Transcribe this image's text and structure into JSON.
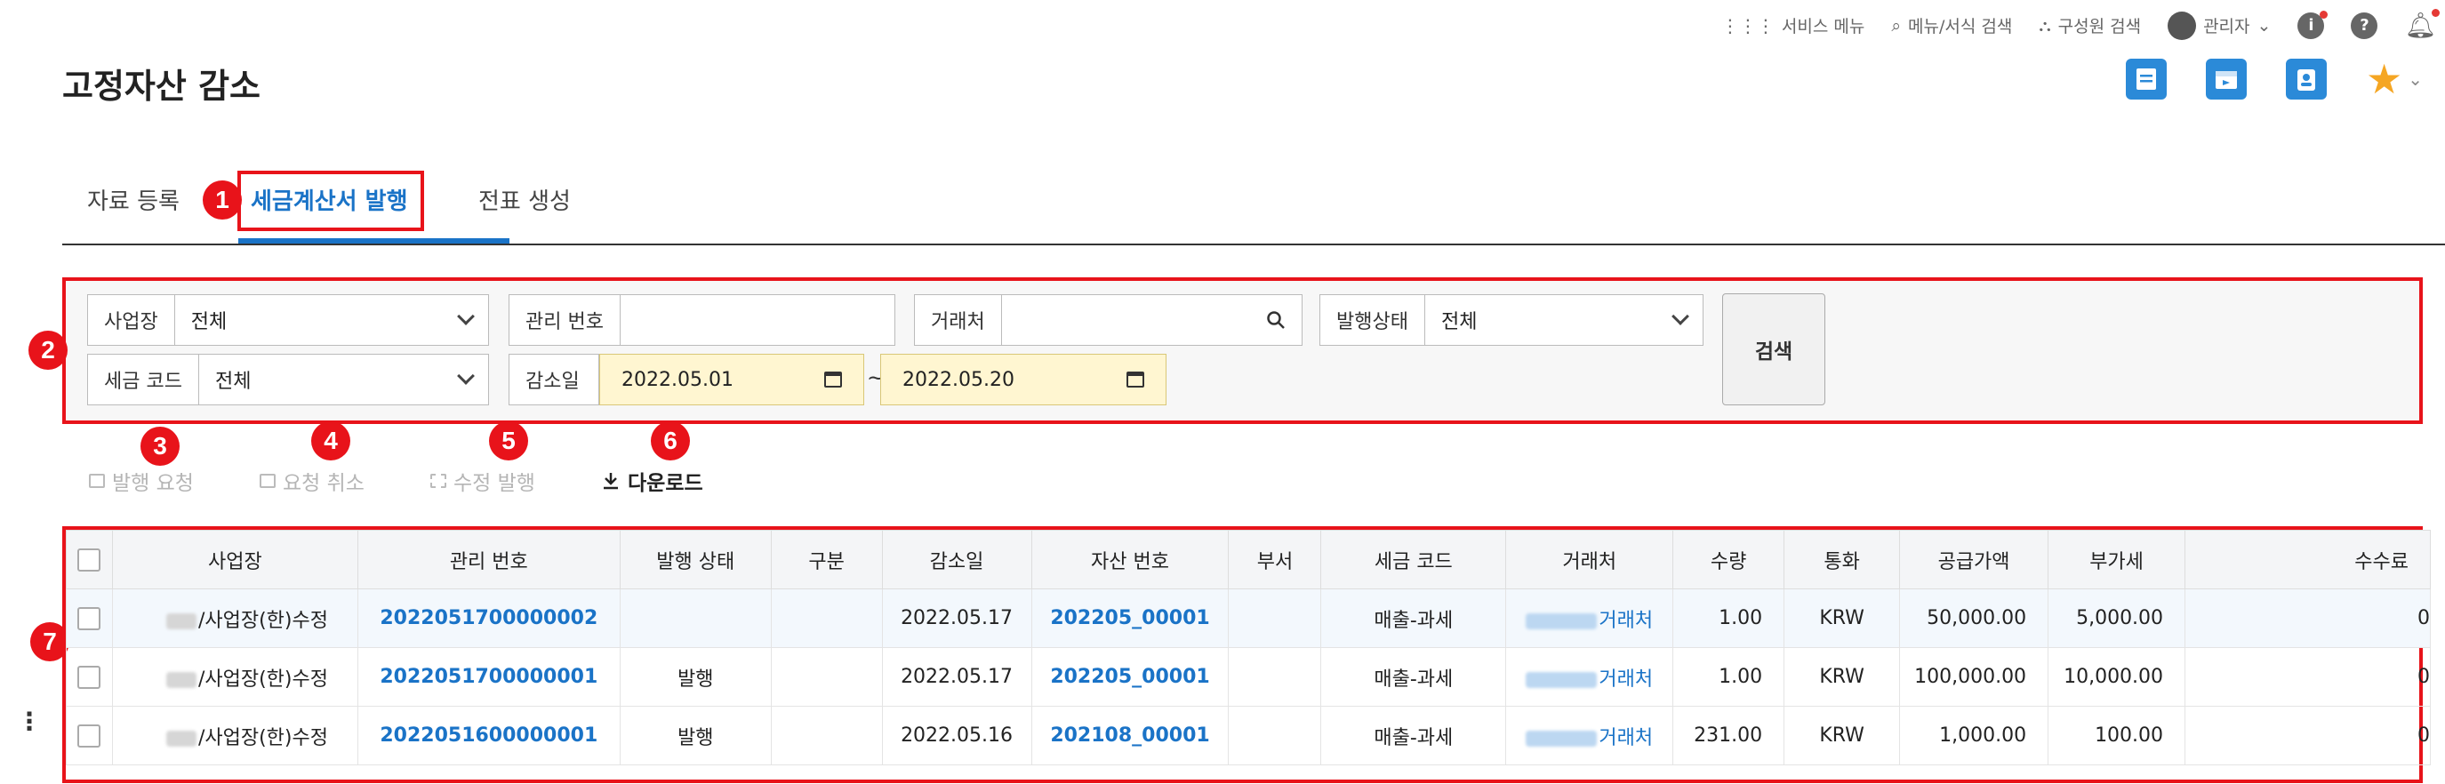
{
  "topbar": {
    "service_menu": "서비스 메뉴",
    "menu_search": "메뉴/서식 검색",
    "member_search": "구성원 검색",
    "user_name": "관리자"
  },
  "page": {
    "title": "고정자산 감소"
  },
  "tabs": [
    {
      "label": "자료 등록",
      "active": false
    },
    {
      "label": "세금계산서 발행",
      "active": true
    },
    {
      "label": "전표 생성",
      "active": false
    }
  ],
  "annotation_badges": [
    "1",
    "2",
    "3",
    "4",
    "5",
    "6",
    "7"
  ],
  "filters": {
    "business_place": {
      "label": "사업장",
      "value": "전체"
    },
    "mgmt_no": {
      "label": "관리 번호",
      "value": ""
    },
    "vendor": {
      "label": "거래처",
      "value": ""
    },
    "issue_status": {
      "label": "발행상태",
      "value": "전체"
    },
    "tax_code": {
      "label": "세금 코드",
      "value": "전체"
    },
    "decrease_date": {
      "label": "감소일",
      "from": "2022.05.01",
      "to": "2022.05.20",
      "separator": "~"
    },
    "search_button": "검색"
  },
  "actions": [
    {
      "label": "발행 요청",
      "enabled": false
    },
    {
      "label": "요청 취소",
      "enabled": false
    },
    {
      "label": "수정 발행",
      "enabled": false
    },
    {
      "label": "다운로드",
      "enabled": true
    }
  ],
  "table": {
    "columns": [
      "사업장",
      "관리 번호",
      "발행 상태",
      "구분",
      "감소일",
      "자산 번호",
      "부서",
      "세금 코드",
      "거래처",
      "수량",
      "통화",
      "공급가액",
      "부가세",
      "수수료"
    ],
    "rows": [
      {
        "business": "/사업장(한)수정",
        "mgmt_no": "2022051700000002",
        "status": "",
        "type": "",
        "date": "2022.05.17",
        "asset_no": "202205_00001",
        "dept": "",
        "tax_code": "매출-과세",
        "vendor": "거래처",
        "qty": "1.00",
        "currency": "KRW",
        "supply": "50,000.00",
        "vat": "5,000.00",
        "fee": "0"
      },
      {
        "business": "/사업장(한)수정",
        "mgmt_no": "2022051700000001",
        "status": "발행",
        "type": "",
        "date": "2022.05.17",
        "asset_no": "202205_00001",
        "dept": "",
        "tax_code": "매출-과세",
        "vendor": "거래처",
        "qty": "1.00",
        "currency": "KRW",
        "supply": "100,000.00",
        "vat": "10,000.00",
        "fee": "0"
      },
      {
        "business": "/사업장(한)수정",
        "mgmt_no": "2022051600000001",
        "status": "발행",
        "type": "",
        "date": "2022.05.16",
        "asset_no": "202108_00001",
        "dept": "",
        "tax_code": "매출-과세",
        "vendor": "거래처",
        "qty": "231.00",
        "currency": "KRW",
        "supply": "1,000.00",
        "vat": "100.00",
        "fee": "0"
      }
    ]
  },
  "colors": {
    "accent": "#1a73c7",
    "annotation": "#e8131a",
    "date_highlight": "#fff6d1"
  }
}
